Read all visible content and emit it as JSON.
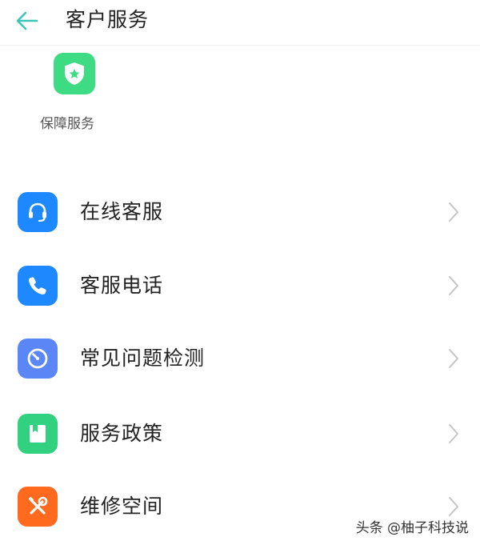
{
  "header": {
    "title": "客户服务",
    "back_icon": "arrow-left-icon",
    "accent_color": "#3cc6b8"
  },
  "quick_services": [
    {
      "label": "保障服务",
      "icon": "shield-star-icon",
      "color": "#3ddc84"
    }
  ],
  "menu": [
    {
      "label": "在线客服",
      "icon": "headset-icon",
      "color": "#1e88ff"
    },
    {
      "label": "客服电话",
      "icon": "phone-icon",
      "color": "#1e88ff"
    },
    {
      "label": "常见问题检测",
      "icon": "gauge-icon",
      "color": "#5b86f5"
    },
    {
      "label": "服务政策",
      "icon": "bookmark-book-icon",
      "color": "#31d17f"
    },
    {
      "label": "维修空间",
      "icon": "tools-icon",
      "color": "#ff6a1f"
    }
  ],
  "watermark": "头条 @柚子科技说"
}
